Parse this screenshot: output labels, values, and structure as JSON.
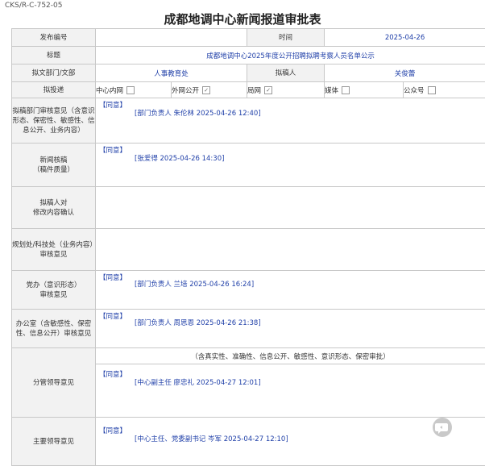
{
  "doc_code": "CKS/R-C-752-05",
  "title": "成都地调中心新闻报道审批表",
  "rows": {
    "publish_no_label": "发布编号",
    "publish_no_value": "",
    "time_label": "时间",
    "time_value": "2025-04-26",
    "subject_label": "标题",
    "subject_value": "成都地调中心2025年度公开招聘拟聘考察人员名单公示",
    "dept_label": "拟文部门/文部",
    "dept_value": "人事教育处",
    "drafter_label": "拟稿人",
    "drafter_value": "关俊蕾",
    "channel_label": "拟投递"
  },
  "channels": [
    {
      "label": "中心内网",
      "checked": ""
    },
    {
      "label": "外网公开",
      "checked": "✓"
    },
    {
      "label": "局网",
      "checked": "✓"
    },
    {
      "label": "媒体",
      "checked": ""
    },
    {
      "label": "公众号",
      "checked": ""
    }
  ],
  "reviews": {
    "dept_opinion_label": "拟稿部门审核意见（含意识形态、保密性、敏感性、信息公开、业务内容）",
    "dept_opinion_agree": "【同意】",
    "dept_opinion_sign": "[部门负责人 朱伦林 2025-04-26 12:40]",
    "news_label_1": "新闻核稿",
    "news_label_2": "（稿件质量）",
    "news_agree": "【同意】",
    "news_sign": "[张爱得 2025-04-26 14:30]",
    "confirm_label_1": "拟稿人对",
    "confirm_label_2": "修改内容确认",
    "plan_label_1": "规划处/科技处（业务内容）",
    "plan_label_2": "审核意见",
    "party_label_1": "党办（意识形态）",
    "party_label_2": "审核意见",
    "party_agree": "【同意】",
    "party_sign": "[部门负责人 兰培 2025-04-26 16:24]",
    "office_label": "办公室（含敏感性、保密性、信息公开）审核意见",
    "office_agree": "【同意】",
    "office_sign": "[部门负责人 周思恩 2025-04-26 21:38]",
    "leader_note": "（含真实性、准确性、信息公开、敏感性、意识形态、保密审批）",
    "leader_label": "分管领导意见",
    "leader_agree": "【同意】",
    "leader_sign": "[中心副主任 廖忠礼 2025-04-27 12:01]",
    "main_label": "主要领导意见",
    "main_agree": "【同意】",
    "main_sign": "[中心主任、党委副书记 岑军 2025-04-27 12:10]"
  },
  "icons": {
    "chat": "chat-bubble-icon"
  }
}
